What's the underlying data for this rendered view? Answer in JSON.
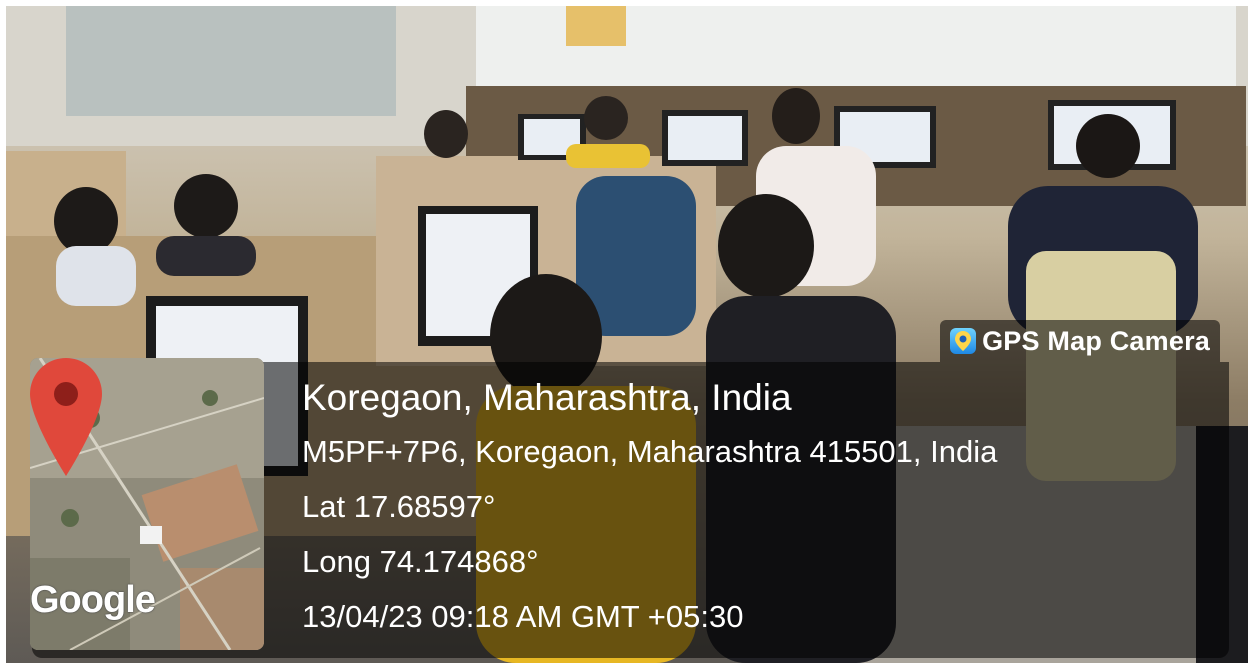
{
  "app_badge": {
    "label": "GPS Map Camera",
    "icon": "gps-map-camera-app-icon"
  },
  "location": {
    "place": "Koregaon, Maharashtra, India",
    "address": "M5PF+7P6, Koregaon, Maharashtra 415501, India",
    "latitude": "Lat 17.68597°",
    "longitude": "Long 74.174868°",
    "timestamp": "13/04/23 09:18 AM GMT +05:30"
  },
  "map": {
    "attribution": "Google",
    "marker_icon": "map-pin-icon",
    "marker_color": "#e0483b"
  }
}
